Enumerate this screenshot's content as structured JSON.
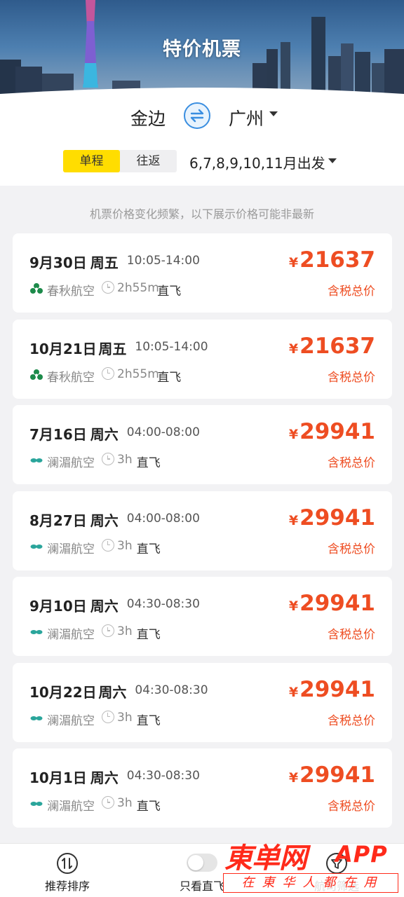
{
  "header": {
    "title": "特价机票"
  },
  "route": {
    "from_city": "金边",
    "to_city": "广州",
    "trip_types": [
      "单程",
      "往返"
    ],
    "active_trip_type": "单程",
    "depart_months": "6,7,8,9,10,11月出发"
  },
  "notice": "机票价格变化频繁，以下展示价格可能非最新",
  "colors": {
    "accent_yellow": "#ffdd00",
    "price_red": "#ee4d22",
    "swap_blue": "#3a8ee0"
  },
  "flights": [
    {
      "date": "9月30日",
      "weekday": "周五",
      "time": "10:05-14:00",
      "airline": "春秋航空",
      "airline_icon": "spring-airlines-icon",
      "duration": "2h55m",
      "direct": "直飞",
      "currency": "¥",
      "price": "21637",
      "price_note": "含税总价"
    },
    {
      "date": "10月21日",
      "weekday": "周五",
      "time": "10:05-14:00",
      "airline": "春秋航空",
      "airline_icon": "spring-airlines-icon",
      "duration": "2h55m",
      "direct": "直飞",
      "currency": "¥",
      "price": "21637",
      "price_note": "含税总价"
    },
    {
      "date": "7月16日",
      "weekday": "周六",
      "time": "04:00-08:00",
      "airline": "澜湄航空",
      "airline_icon": "lanmei-airlines-icon",
      "duration": "3h",
      "direct": "直飞",
      "currency": "¥",
      "price": "29941",
      "price_note": "含税总价"
    },
    {
      "date": "8月27日",
      "weekday": "周六",
      "time": "04:00-08:00",
      "airline": "澜湄航空",
      "airline_icon": "lanmei-airlines-icon",
      "duration": "3h",
      "direct": "直飞",
      "currency": "¥",
      "price": "29941",
      "price_note": "含税总价"
    },
    {
      "date": "9月10日",
      "weekday": "周六",
      "time": "04:30-08:30",
      "airline": "澜湄航空",
      "airline_icon": "lanmei-airlines-icon",
      "duration": "3h",
      "direct": "直飞",
      "currency": "¥",
      "price": "29941",
      "price_note": "含税总价"
    },
    {
      "date": "10月22日",
      "weekday": "周六",
      "time": "04:30-08:30",
      "airline": "澜湄航空",
      "airline_icon": "lanmei-airlines-icon",
      "duration": "3h",
      "direct": "直飞",
      "currency": "¥",
      "price": "29941",
      "price_note": "含税总价"
    },
    {
      "date": "10月1日",
      "weekday": "周六",
      "time": "04:30-08:30",
      "airline": "澜湄航空",
      "airline_icon": "lanmei-airlines-icon",
      "duration": "3h",
      "direct": "直飞",
      "currency": "¥",
      "price": "29941",
      "price_note": "含税总价"
    }
  ],
  "bottom_bar": {
    "sort_label": "推荐排序",
    "direct_only_label": "只看直飞",
    "direct_only_on": false,
    "filter_label": "航司筛选"
  },
  "watermark": {
    "main": "東单网",
    "app": "APP",
    "sub": "在東华人都在用"
  }
}
